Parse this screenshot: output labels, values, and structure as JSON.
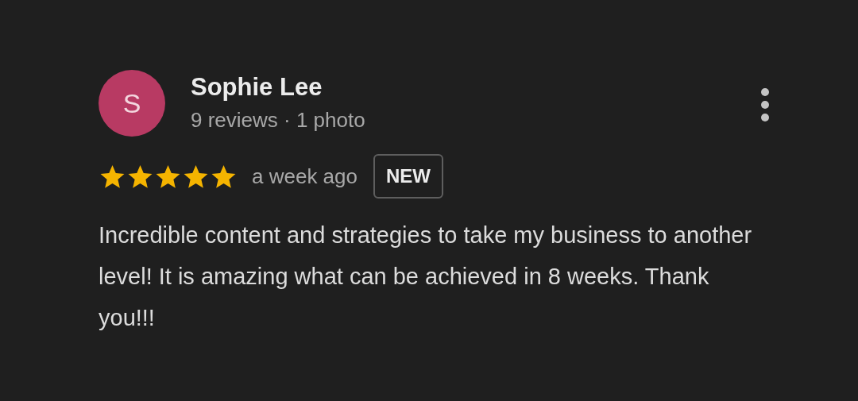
{
  "review": {
    "avatar_letter": "S",
    "author": "Sophie Lee",
    "meta": "9 reviews · 1 photo",
    "stars": 5,
    "time": "a week ago",
    "badge": "NEW",
    "text": "Incredible content and strategies to take my business to another level! It is amazing what can be achieved in 8 weeks. Thank you!!!"
  }
}
